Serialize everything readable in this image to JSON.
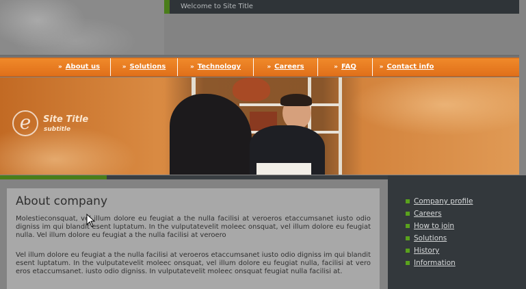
{
  "header": {
    "welcome_text": "Welcome to Site Title"
  },
  "nav": {
    "items": [
      {
        "label": "About us",
        "icon": "double-chevron-right-icon"
      },
      {
        "label": "Solutions",
        "icon": "double-chevron-right-icon"
      },
      {
        "label": "Technology",
        "icon": "double-chevron-right-icon"
      },
      {
        "label": "Careers",
        "icon": "double-chevron-right-icon"
      },
      {
        "label": "FAQ",
        "icon": "double-chevron-right-icon"
      },
      {
        "label": "Contact info",
        "icon": "double-chevron-right-icon"
      }
    ],
    "arrow_glyph": "»"
  },
  "hero": {
    "logo_letter": "e",
    "site_title": "Site Title",
    "subtitle": "subtitle"
  },
  "main": {
    "title": "About company",
    "paragraph_1": "Molestieconsquat, vel illum dolore eu feugiat a the nulla facilisi at veroeros etaccumsanet iusto odio digniss im qui blandit esent luptatum. In the vulputatevelit moleec onsquat, vel illum dolore eu feugiat nulla. Vel illum dolore eu feugiat a the nulla facilisi at veroero",
    "paragraph_2": "Vel illum dolore eu feugiat a the nulla facilisi at veroeros etaccumsanet iusto odio digniss im qui blandit esent luptatum. In the vulputatevelit moleec onsquat, vel illum dolore eu feugiat nulla, facilisi at vero eros etaccumsanet. iusto odio digniss. In vulputatevelit moleec onsquat feugiat nulla facilisi at."
  },
  "sidebar": {
    "links": [
      {
        "label": "Company profile"
      },
      {
        "label": "Careers"
      },
      {
        "label": "How to join"
      },
      {
        "label": "Solutions"
      },
      {
        "label": "History"
      },
      {
        "label": "Information"
      }
    ]
  },
  "colors": {
    "nav_orange": "#f08a2a",
    "accent_green": "#4a7d1a",
    "bullet_green": "#5aa21d",
    "sidebar_dark": "#33383c",
    "welcome_bar": "#2f3438",
    "content_gray": "#a8a8a8"
  }
}
